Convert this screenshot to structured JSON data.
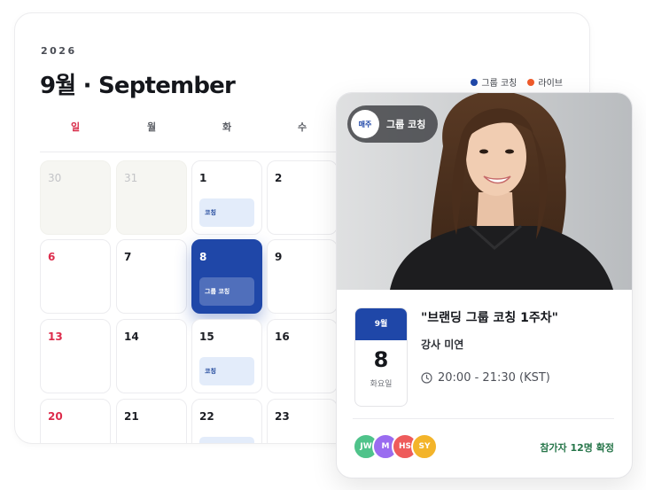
{
  "calendar": {
    "year": "2026",
    "title": "9월 · September",
    "legend": [
      {
        "label": "그룹 코칭",
        "color": "#1f47a8"
      },
      {
        "label": "라이브",
        "color": "#ef5a2a"
      }
    ],
    "weekdays": [
      "일",
      "월",
      "화",
      "수"
    ],
    "days": {
      "d30": "30",
      "d31": "31",
      "d1": "1",
      "d2": "2",
      "d6": "6",
      "d7": "7",
      "d8": "8",
      "d9": "9",
      "d13": "13",
      "d14": "14",
      "d15": "15",
      "d16": "16",
      "d20": "20",
      "d21": "21",
      "d22": "22",
      "d23": "23"
    },
    "events": {
      "d1": "코칭",
      "d8": "그룹 코칭",
      "d15": "코칭"
    },
    "accent": "#1f47a8"
  },
  "event_card": {
    "badge_small": "매주",
    "badge_label": "그룹 코칭",
    "month": "9월",
    "day": "8",
    "weekday": "화요일",
    "title": "\"브랜딩 그룹 코칭 1주차\"",
    "host": "강사 미연",
    "time": "20:00 - 21:30 (KST)",
    "avatars": [
      {
        "initials": "JW",
        "color": "#4fc38a"
      },
      {
        "initials": "M",
        "color": "#9a6cf0"
      },
      {
        "initials": "HS",
        "color": "#ee5b5b"
      },
      {
        "initials": "SY",
        "color": "#f3b42a"
      }
    ],
    "participants": "참가자 12명 확정",
    "icons": {
      "time": "clock-icon"
    }
  }
}
